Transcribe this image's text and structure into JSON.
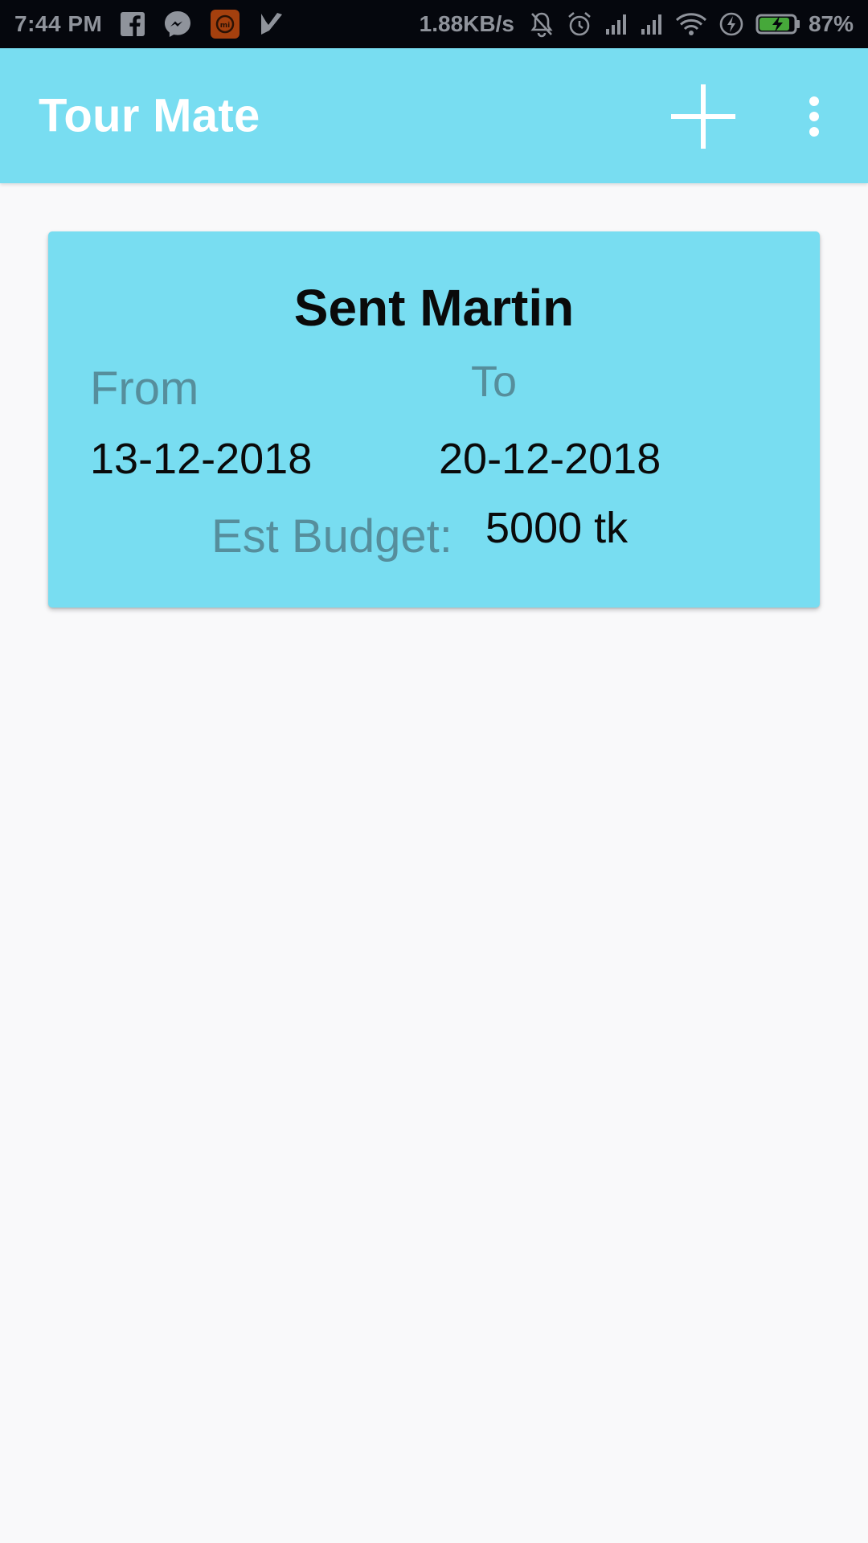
{
  "status_bar": {
    "time": "7:44 PM",
    "network_speed": "1.88KB/s",
    "battery_percent": "87%",
    "icons": [
      "facebook-icon",
      "messenger-icon",
      "app-notification-icon",
      "tick-notification-icon",
      "notifications-off-icon",
      "alarm-icon",
      "signal-icon",
      "signal-icon",
      "wifi-icon",
      "charging-icon",
      "battery-icon"
    ]
  },
  "app_bar": {
    "title": "Tour Mate",
    "actions": [
      "add-icon",
      "more-vert-icon"
    ],
    "color": "#78ddf1"
  },
  "tours": [
    {
      "name": "Sent Martin",
      "from_label": "From",
      "from_date": "13-12-2018",
      "to_label": "To",
      "to_date": "20-12-2018",
      "budget_label": "Est Budget:",
      "budget_value": "5000 tk"
    }
  ],
  "colors": {
    "accent": "#78ddf1",
    "label_muted": "#568e9c",
    "background": "#f9f9fa",
    "battery_fill": "#46a83a"
  }
}
